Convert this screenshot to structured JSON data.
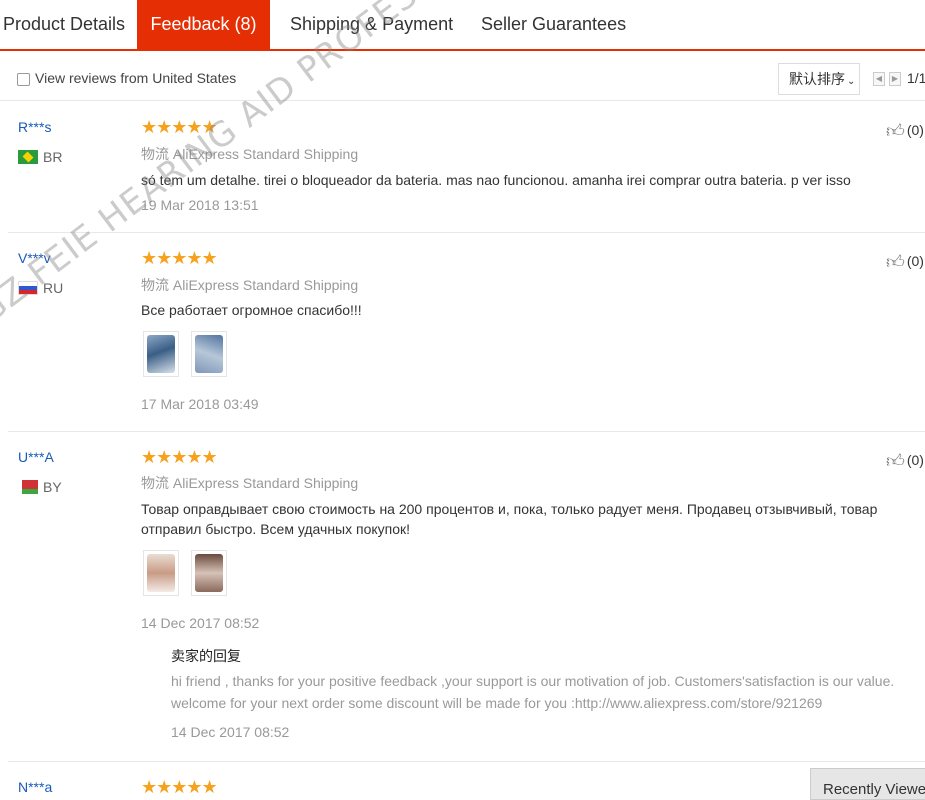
{
  "tabs": [
    {
      "label": "Product Details"
    },
    {
      "label": "Feedback (8)"
    },
    {
      "label": "Shipping & Payment"
    },
    {
      "label": "Seller Guarantees"
    }
  ],
  "filter": {
    "checkbox_label": "View reviews from United States",
    "sort_label": "默认排序",
    "pagination": "1/1"
  },
  "reviews": [
    {
      "user": "R***s",
      "country": "BR",
      "rating": 5,
      "stars": "★★★★★",
      "shipping": "物流 AliExpress Standard Shipping",
      "comment": "só tem um detalhe. tirei o bloqueador da bateria. mas nao funcionou. amanha irei comprar outra bateria. p ver isso",
      "date": "19 Mar 2018 13:51",
      "useful": "(0)"
    },
    {
      "user": "V***v",
      "country": "RU",
      "rating": 5,
      "stars": "★★★★★",
      "shipping": "物流 AliExpress Standard Shipping",
      "comment": "Все работает огромное спасибо!!!",
      "date": "17 Mar 2018 03:49",
      "useful": "(0)"
    },
    {
      "user": "U***A",
      "country": "BY",
      "rating": 5,
      "stars": "★★★★★",
      "shipping": "物流 AliExpress Standard Shipping",
      "comment": "Товар оправдывает свою стоимость на 200 процентов и, пока, только радует меня. Продавец отзывчивый, товар отправил быстро. Всем удачных покупок!",
      "date": "14 Dec 2017 08:52",
      "useful": "(0)",
      "reply": {
        "title": "卖家的回复",
        "text": "hi friend , thanks for your positive feedback ,your support is our motivation of job. Customers'satisfaction is our value. welcome for your next order some discount will be made for you :http://www.aliexpress.com/store/921269",
        "date": "14 Dec 2017 08:52"
      }
    },
    {
      "user": "N***a",
      "rating": 5,
      "stars": "★★★★★"
    }
  ],
  "recently_viewed": "Recently Viewed",
  "watermark": "GZ FEIE HEARING AID PROFESSIONAL PERSON Factory Store",
  "colors": {
    "accent": "#e62e04",
    "star": "#f6a21e",
    "link": "#1a5bb8"
  }
}
